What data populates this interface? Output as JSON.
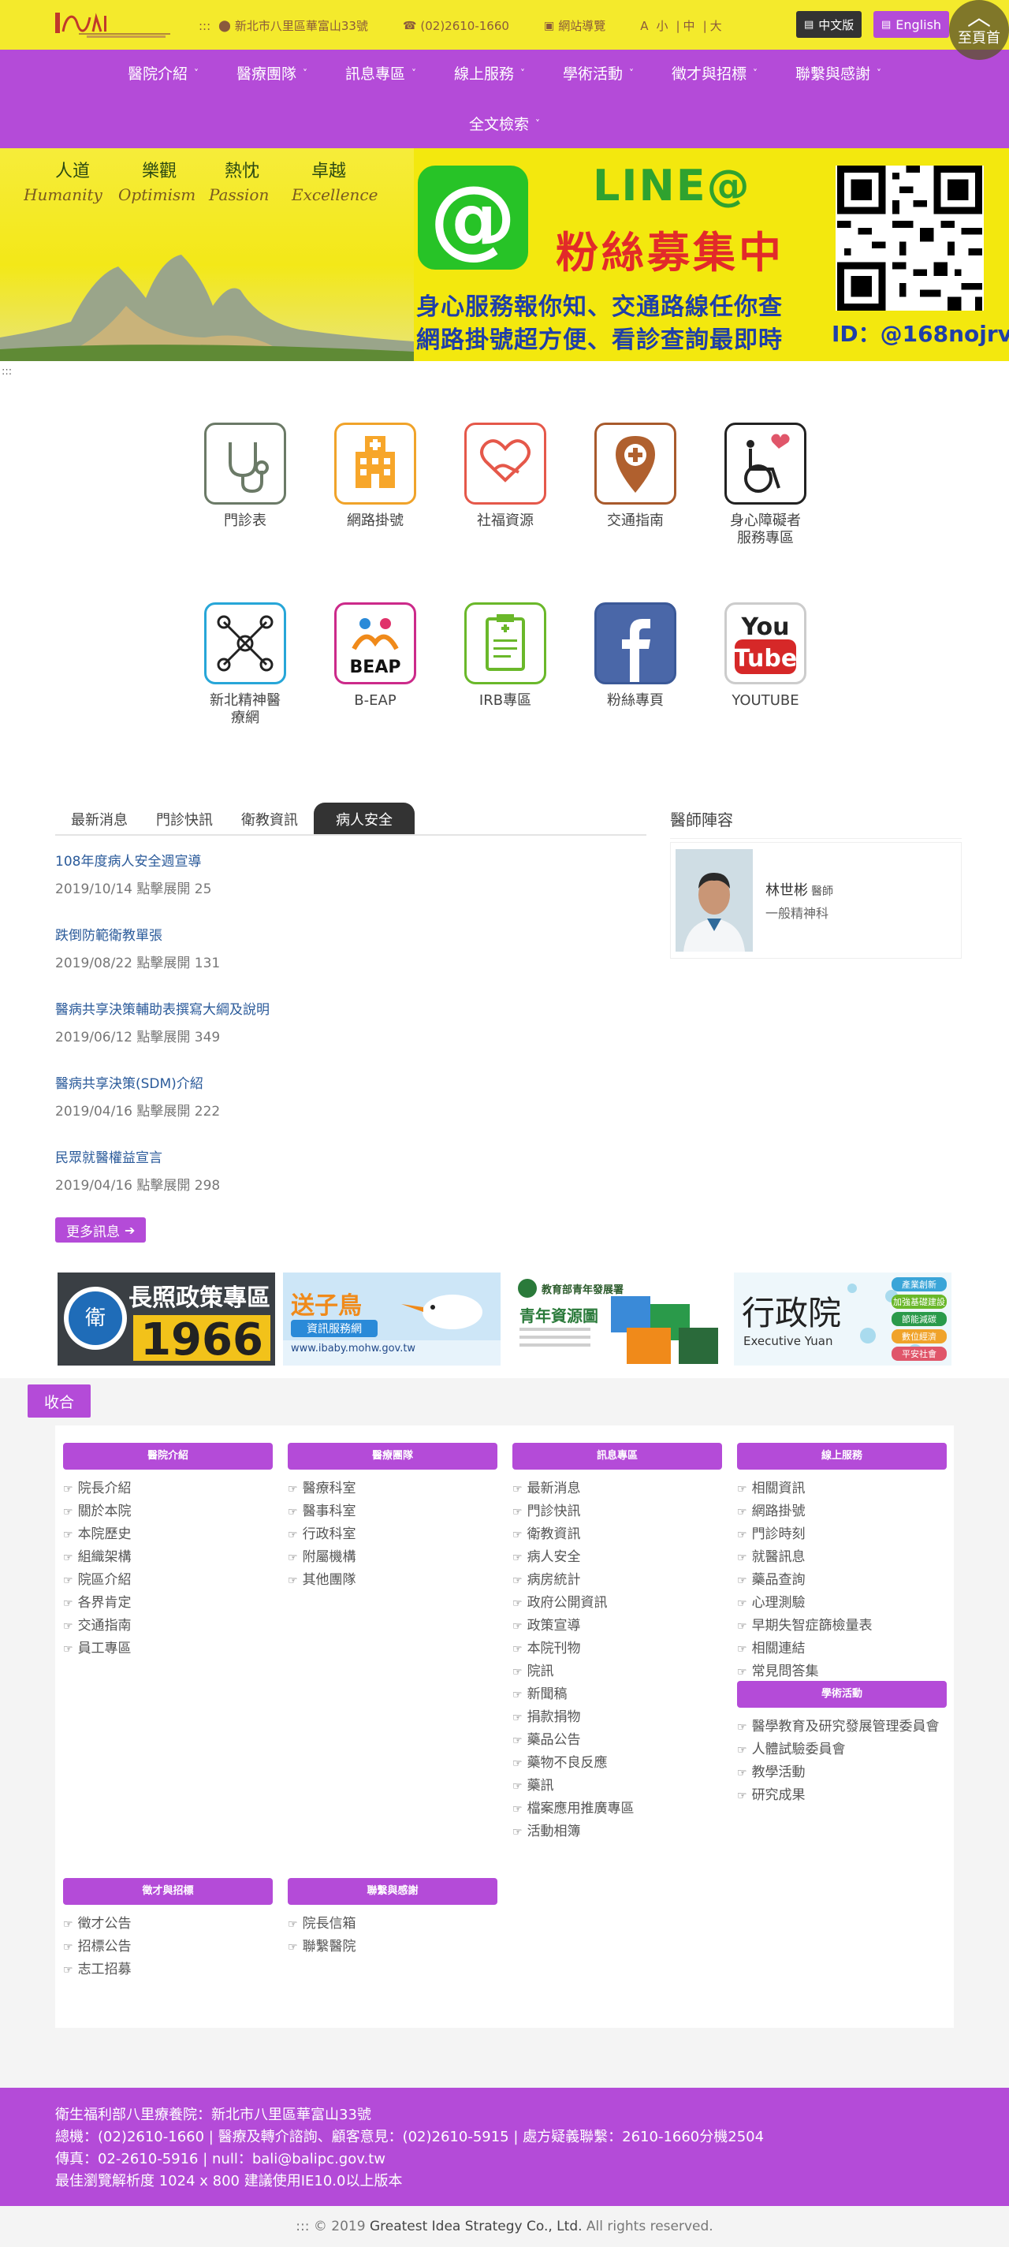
{
  "header": {
    "address": "新北市八里區華富山33號",
    "phone": "(02)2610-1660",
    "sitemap_label": "網站導覽",
    "font_size_label": "A",
    "font_sizes": [
      "小",
      "中",
      "大"
    ],
    "lang_zh": "中文版",
    "lang_en": "English",
    "to_top": "至頁首"
  },
  "nav": {
    "row1": [
      "醫院介紹",
      "醫療團隊",
      "訊息專區",
      "線上服務",
      "學術活動",
      "徵才與招標",
      "聯繫與感謝"
    ],
    "row2": [
      "全文檢索"
    ]
  },
  "banner": {
    "slogan_words": [
      "人道",
      "樂觀",
      "熱忱",
      "卓越"
    ],
    "slogan_letters": [
      "Humanity",
      "Optimism",
      "Passion",
      "Excellence"
    ],
    "line_title": "LINE@",
    "fans": "粉絲募集中",
    "line1": "身心服務報你知、交通路線任你查",
    "line2": "網路掛號超方便、看診查詢最即時",
    "id": "ID：@168nojrv"
  },
  "breadcrumb_dots": ":::",
  "quick_links": [
    {
      "label": "門診表",
      "icon": "stethoscope-icon"
    },
    {
      "label": "網路掛號",
      "icon": "hospital-icon"
    },
    {
      "label": "社福資源",
      "icon": "heart-hand-icon"
    },
    {
      "label": "交通指南",
      "icon": "map-pin-icon"
    },
    {
      "label": "身心障礙者服務專區",
      "icon": "wheelchair-icon"
    },
    {
      "label": "新北精神醫療網",
      "icon": "network-icon"
    },
    {
      "label": "B-EAP",
      "icon": "beap-icon"
    },
    {
      "label": "IRB專區",
      "icon": "clipboard-icon"
    },
    {
      "label": "粉絲專頁",
      "icon": "facebook-icon"
    },
    {
      "label": "YOUTUBE",
      "icon": "youtube-icon"
    }
  ],
  "tabs": [
    "最新消息",
    "門診快訊",
    "衛教資訊",
    "病人安全"
  ],
  "news": [
    {
      "title": "108年度病人安全週宣導",
      "date": "2019/10/14",
      "views_label": "點擊展開",
      "views": "25"
    },
    {
      "title": "跌倒防範衛教單張",
      "date": "2019/08/22",
      "views_label": "點擊展開",
      "views": "131"
    },
    {
      "title": "醫病共享決策輔助表撰寫大綱及說明",
      "date": "2019/06/12",
      "views_label": "點擊展開",
      "views": "349"
    },
    {
      "title": "醫病共享決策(SDM)介紹",
      "date": "2019/04/16",
      "views_label": "點擊展開",
      "views": "222"
    },
    {
      "title": "民眾就醫權益宣言",
      "date": "2019/04/16",
      "views_label": "點擊展開",
      "views": "298"
    }
  ],
  "more_label": "更多訊息",
  "doctors": {
    "heading": "醫師陣容",
    "name": "林世彬",
    "title": "醫師",
    "dept": "一般精神科"
  },
  "partners": {
    "p1_title": "長照政策專區",
    "p1_number": "1966",
    "p2_title": "送子鳥",
    "p2_sub": "資訊服務網",
    "p2_url": "www.ibaby.mohw.gov.tw",
    "p3_org": "教育部青年發展署",
    "p3_title": "青年資源圖",
    "p4_title": "行政院",
    "p4_sub": "Executive Yuan",
    "p4_menu": [
      "產業創新",
      "加強基礎建設",
      "節能減碳",
      "數位經濟",
      "平安社會"
    ]
  },
  "collapse_label": "收合",
  "sitemap": [
    {
      "head": "醫院介紹",
      "links": [
        "院長介紹",
        "關於本院",
        "本院歷史",
        "組織架構",
        "院區介紹",
        "各界肯定",
        "交通指南",
        "員工專區"
      ]
    },
    {
      "head": "醫療團隊",
      "links": [
        "醫療科室",
        "醫事科室",
        "行政科室",
        "附屬機構",
        "其他團隊"
      ]
    },
    {
      "head": "訊息專區",
      "links": [
        "最新消息",
        "門診快訊",
        "衛教資訊",
        "病人安全",
        "病房統計",
        "政府公開資訊",
        "政策宣導",
        "本院刊物",
        "院訊",
        "新聞稿",
        "捐款捐物",
        "藥品公告",
        "藥物不良反應",
        "藥訊",
        "檔案應用推廣專區",
        "活動相簿"
      ]
    },
    {
      "head": "線上服務",
      "links": [
        "相關資訊",
        "網路掛號",
        "門診時刻",
        "就醫訊息",
        "藥品查詢",
        "心理測驗",
        "早期失智症篩檢量表",
        "相關連結",
        "常見問答集"
      ]
    },
    {
      "head": "學術活動",
      "links": [
        "醫學教育及研究發展管理委員會",
        "人體試驗委員會",
        "教學活動",
        "研究成果"
      ]
    },
    {
      "head": "徵才與招標",
      "links": [
        "徵才公告",
        "招標公告",
        "志工招募"
      ]
    },
    {
      "head": "聯繫與感謝",
      "links": [
        "院長信箱",
        "聯繫醫院"
      ]
    }
  ],
  "footer": {
    "line1": "衛生福利部八里療養院：新北市八里區華富山33號",
    "line2": "總機：(02)2610-1660 | 醫療及轉介諮詢、顧客意見：(02)2610-5915 | 處方疑義聯繫：2610-1660分機2504",
    "line3": "傳真：02-2610-5916 | null：bali@balipc.gov.tw",
    "line4": "最佳瀏覽解析度 1024 x 800 建議使用IE10.0以上版本"
  },
  "copyright": {
    "prefix": "::: © 2019",
    "company": "Greatest Idea Strategy Co., Ltd.",
    "suffix": "All rights reserved."
  },
  "colors": {
    "brand_purple": "#b44bd8",
    "top_yellow": "#f4ea2c",
    "line_green": "#27c327",
    "link_blue": "#2a5a9a"
  }
}
